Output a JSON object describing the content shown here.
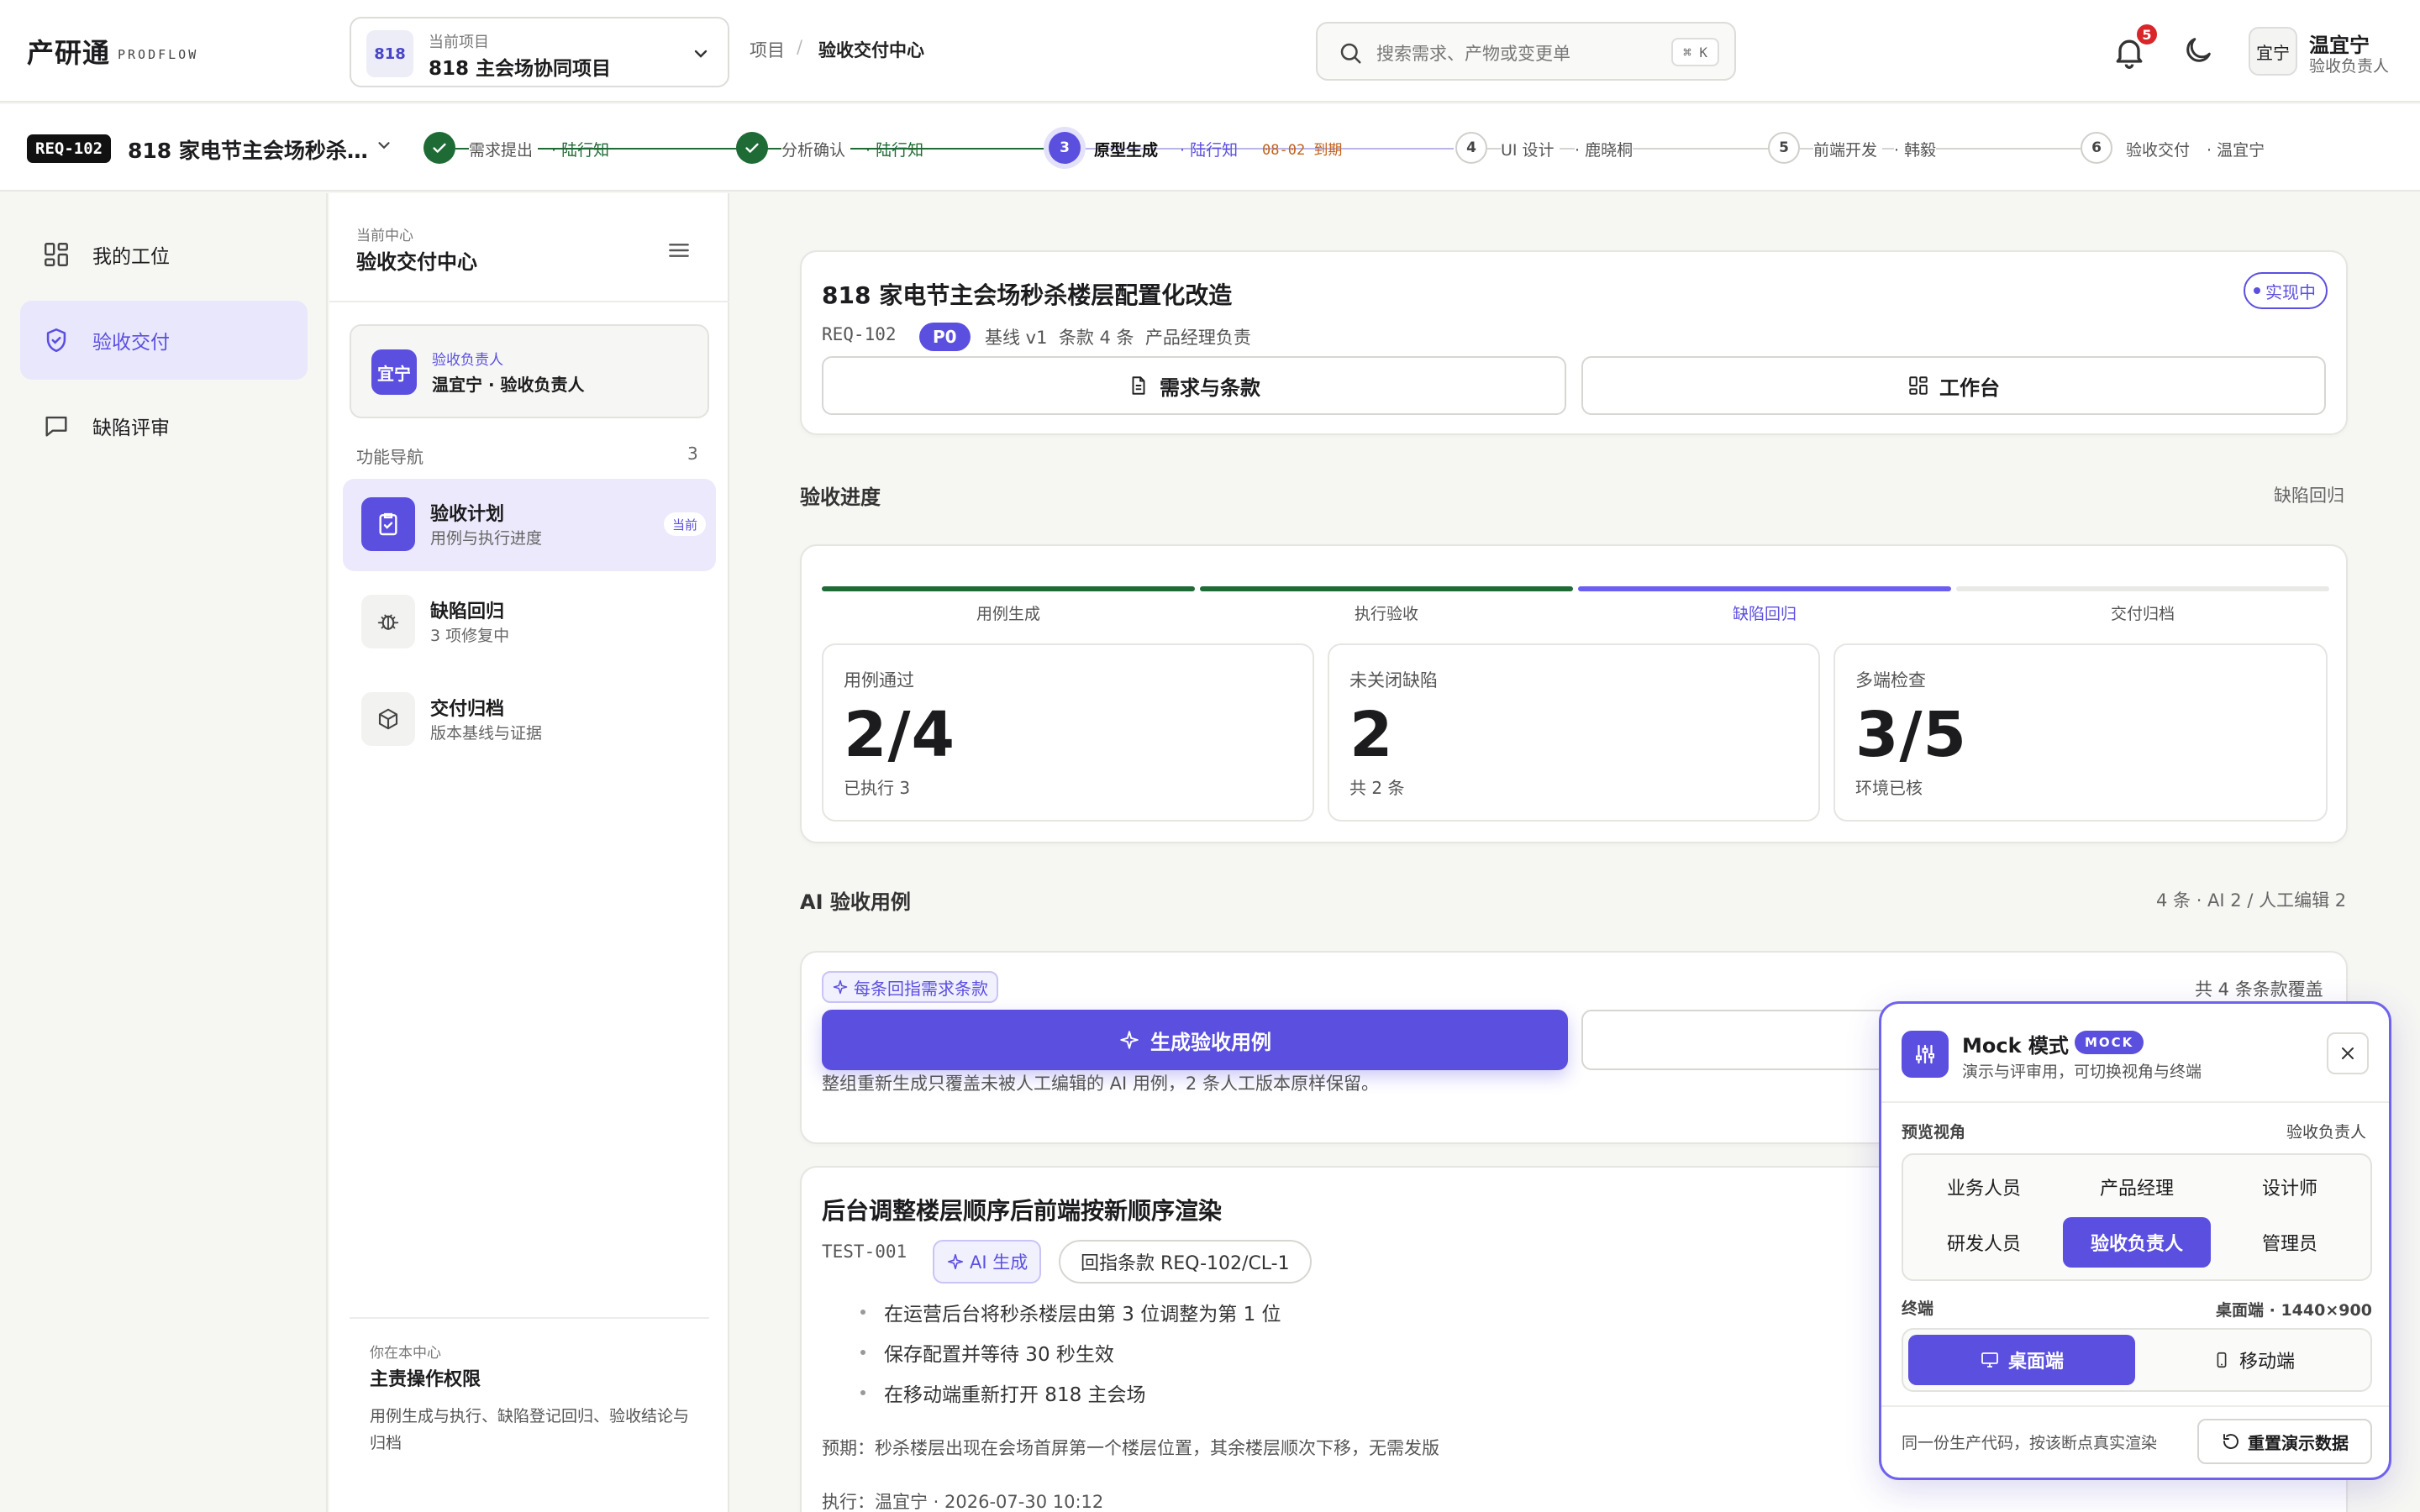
{
  "brand": {
    "name": "产研通",
    "sub": "PRODFLOW"
  },
  "project": {
    "badge": "818",
    "label": "当前项目",
    "value": "818 主会场协同项目"
  },
  "breadcrumb": {
    "root": "项目",
    "sep": "/",
    "current": "验收交付中心"
  },
  "search": {
    "placeholder": "搜索需求、产物或变更单",
    "shortcut": "⌘ K"
  },
  "notifications": {
    "count": "5"
  },
  "user": {
    "avatar": "宜宁",
    "name": "温宜宁",
    "role": "验收负责人"
  },
  "requirement": {
    "id": "REQ-102",
    "title": "818 家电节主会场秒杀…"
  },
  "steps": [
    {
      "num": "1",
      "label": "需求提出",
      "owner": "· 陆行知",
      "state": "done"
    },
    {
      "num": "2",
      "label": "分析确认",
      "owner": "· 陆行知",
      "state": "done"
    },
    {
      "num": "3",
      "label": "原型生成",
      "owner": "· 陆行知",
      "state": "current",
      "due": "08-02 到期"
    },
    {
      "num": "4",
      "label": "UI 设计",
      "owner": "· 鹿晓桐",
      "state": "todo"
    },
    {
      "num": "5",
      "label": "前端开发",
      "owner": "· 韩毅",
      "state": "todo"
    },
    {
      "num": "6",
      "label": "验收交付",
      "owner": "· 温宜宁",
      "state": "todo"
    }
  ],
  "sidebar": {
    "items": [
      {
        "label": "我的工位",
        "icon": "grid-icon"
      },
      {
        "label": "验收交付",
        "icon": "shield-icon"
      },
      {
        "label": "缺陷评审",
        "icon": "chat-icon"
      }
    ]
  },
  "center": {
    "label": "当前中心",
    "title": "验收交付中心",
    "owner": {
      "avatar": "宜宁",
      "label": "验收负责人",
      "value": "温宜宁 · 验收负责人"
    },
    "nav_label": "功能导航",
    "nav_count": "3",
    "functions": [
      {
        "title": "验收计划",
        "sub": "用例与执行进度",
        "pill": "当前",
        "icon": "clipboard-check-icon"
      },
      {
        "title": "缺陷回归",
        "sub": "3 项修复中",
        "icon": "bug-icon"
      },
      {
        "title": "交付归档",
        "sub": "版本基线与证据",
        "icon": "box-icon"
      }
    ],
    "footer": {
      "label": "你在本中心",
      "title": "主责操作权限",
      "desc": "用例生成与执行、缺陷登记回归、验收结论与归档"
    }
  },
  "req_card": {
    "title": "818 家电节主会场秒杀楼层配置化改造",
    "status": "实现中",
    "id": "REQ-102",
    "priority": "P0",
    "meta": "基线 v1  条款 4 条  产品经理负责",
    "btn_clauses": "需求与条款",
    "btn_workbench": "工作台"
  },
  "progress": {
    "title": "验收进度",
    "right": "缺陷回归",
    "stages": [
      {
        "label": "用例生成",
        "state": "done"
      },
      {
        "label": "执行验收",
        "state": "done"
      },
      {
        "label": "缺陷回归",
        "state": "current"
      },
      {
        "label": "交付归档",
        "state": "todo"
      }
    ],
    "stats": [
      {
        "label": "用例通过",
        "value": "2/4",
        "sub": "已执行 3"
      },
      {
        "label": "未关闭缺陷",
        "value": "2",
        "sub": "共 2 条"
      },
      {
        "label": "多端检查",
        "value": "3/5",
        "sub": "环境已核"
      }
    ]
  },
  "ai_cases": {
    "title": "AI 验收用例",
    "right": "4 条 · AI 2 / 人工编辑 2",
    "tag": "每条回指需求条款",
    "coverage": "共 4 条条款覆盖",
    "generate": "生成验收用例",
    "note": "整组重新生成只覆盖未被人工编辑的 AI 用例，2 条人工版本原样保留。"
  },
  "test_case": {
    "title": "后台调整楼层顺序后前端按新顺序渲染",
    "id": "TEST-001",
    "ai_tag": "AI 生成",
    "ref": "回指条款 REQ-102/CL-1",
    "steps": [
      "在运营后台将秒杀楼层由第 3 位调整为第 1 位",
      "保存配置并等待 30 秒生效",
      "在移动端重新打开 818 主会场"
    ],
    "expected": "预期：秒杀楼层出现在会场首屏第一个楼层位置，其余楼层顺次下移，无需发版",
    "exec": "执行：温宜宁 · 2026-07-30 10:12"
  },
  "mock": {
    "title": "Mock 模式",
    "badge": "MOCK",
    "desc": "演示与评审用，可切换视角与终端",
    "view_label": "预览视角",
    "view_current": "验收负责人",
    "roles": [
      "业务人员",
      "产品经理",
      "设计师",
      "研发人员",
      "验收负责人",
      "管理员"
    ],
    "active_role": 4,
    "device_label": "终端",
    "device_current": "桌面端 · 1440×900",
    "devices": [
      "桌面端",
      "移动端"
    ],
    "footer": "同一份生产代码，按该断点真实渲染",
    "reset": "重置演示数据"
  },
  "colors": {
    "accent": "#5b4fe0",
    "done": "#1f6b35",
    "warn": "#c2611a"
  }
}
